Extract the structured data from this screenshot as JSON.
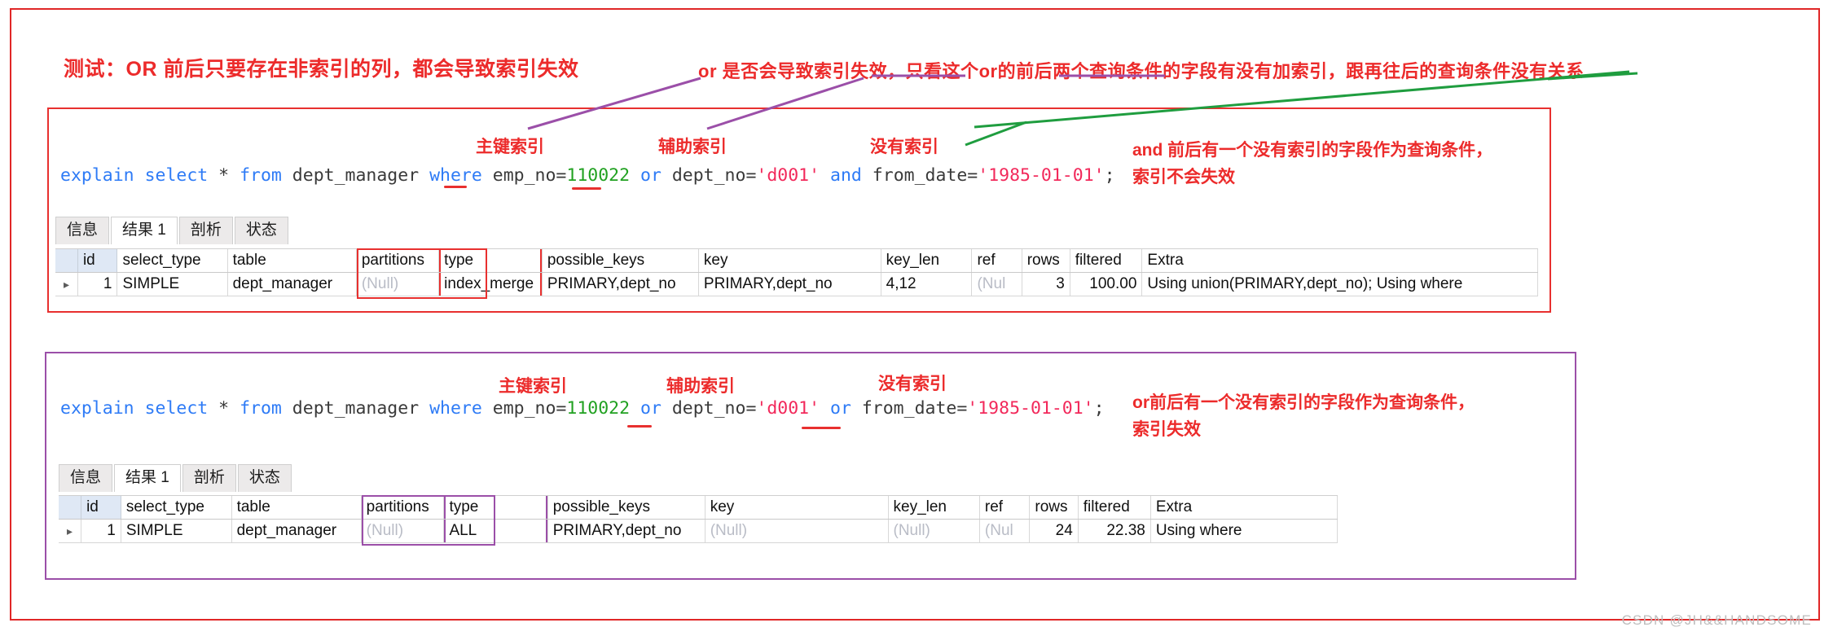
{
  "headlines": {
    "main_title": "测试：OR 前后只要存在非索引的列，都会导致索引失效",
    "or_rule": "or 是否会导致索引失效，只看这个or的前后两个查询条件的字段有没有加索引，跟再往后的查询条件没有关系"
  },
  "labels": {
    "primary_index": "主键索引",
    "secondary_index": "辅助索引",
    "no_index": "没有索引"
  },
  "blocks": [
    {
      "id": "and-block",
      "accent": "#e8302f",
      "note_line1": "and 前后有一个没有索引的字段作为查询条件，",
      "note_line2": "索引不会失效",
      "sql": {
        "full": "explain select * from dept_manager where emp_no=110022 or dept_no='d001' and from_date='1985-01-01';",
        "tokens": [
          {
            "t": "explain",
            "c": "kw"
          },
          {
            "t": " ",
            "c": "plain"
          },
          {
            "t": "select",
            "c": "kw"
          },
          {
            "t": " * ",
            "c": "plain"
          },
          {
            "t": "from",
            "c": "kw"
          },
          {
            "t": " dept_manager ",
            "c": "plain"
          },
          {
            "t": "where",
            "c": "kw"
          },
          {
            "t": " emp_no=",
            "c": "plain"
          },
          {
            "t": "110022",
            "c": "num"
          },
          {
            "t": " ",
            "c": "plain"
          },
          {
            "t": "or",
            "c": "kw"
          },
          {
            "t": " dept_no=",
            "c": "plain"
          },
          {
            "t": "'d001'",
            "c": "str"
          },
          {
            "t": " ",
            "c": "plain"
          },
          {
            "t": "and",
            "c": "kw"
          },
          {
            "t": " from_date=",
            "c": "plain"
          },
          {
            "t": "'1985-01-01'",
            "c": "str"
          },
          {
            "t": ";",
            "c": "plain"
          }
        ]
      },
      "tabs": [
        {
          "label": "信息",
          "active": false
        },
        {
          "label": "结果 1",
          "active": true
        },
        {
          "label": "剖析",
          "active": false
        },
        {
          "label": "状态",
          "active": false
        }
      ],
      "grid": {
        "columns": [
          "id",
          "select_type",
          "table",
          "partitions",
          "type",
          "possible_keys",
          "key",
          "key_len",
          "ref",
          "rows",
          "filtered",
          "Extra"
        ],
        "rows": [
          {
            "marker": "▸",
            "cells": [
              "1",
              "SIMPLE",
              "dept_manager",
              "(Null)",
              "index_merge",
              "PRIMARY,dept_no",
              "PRIMARY,dept_no",
              "4,12",
              "(Nul",
              "3",
              "100.00",
              "Using union(PRIMARY,dept_no); Using where"
            ]
          }
        ]
      }
    },
    {
      "id": "or-block",
      "accent": "#9b4fa8",
      "note_line1": "or前后有一个没有索引的字段作为查询条件，",
      "note_line2": "索引失效",
      "sql": {
        "full": "explain select * from dept_manager where emp_no=110022 or dept_no='d001' or from_date='1985-01-01';",
        "tokens": [
          {
            "t": "explain",
            "c": "kw"
          },
          {
            "t": " ",
            "c": "plain"
          },
          {
            "t": "select",
            "c": "kw"
          },
          {
            "t": " * ",
            "c": "plain"
          },
          {
            "t": "from",
            "c": "kw"
          },
          {
            "t": " dept_manager ",
            "c": "plain"
          },
          {
            "t": "where",
            "c": "kw"
          },
          {
            "t": " emp_no=",
            "c": "plain"
          },
          {
            "t": "110022",
            "c": "num"
          },
          {
            "t": " ",
            "c": "plain"
          },
          {
            "t": "or",
            "c": "kw"
          },
          {
            "t": " dept_no=",
            "c": "plain"
          },
          {
            "t": "'d001'",
            "c": "str"
          },
          {
            "t": " ",
            "c": "plain"
          },
          {
            "t": "or",
            "c": "kw"
          },
          {
            "t": " from_date=",
            "c": "plain"
          },
          {
            "t": "'1985-01-01'",
            "c": "str"
          },
          {
            "t": ";",
            "c": "plain"
          }
        ]
      },
      "tabs": [
        {
          "label": "信息",
          "active": false
        },
        {
          "label": "结果 1",
          "active": true
        },
        {
          "label": "剖析",
          "active": false
        },
        {
          "label": "状态",
          "active": false
        }
      ],
      "grid": {
        "columns": [
          "id",
          "select_type",
          "table",
          "partitions",
          "type",
          "possible_keys",
          "key",
          "key_len",
          "ref",
          "rows",
          "filtered",
          "Extra"
        ],
        "rows": [
          {
            "marker": "▸",
            "cells": [
              "1",
              "SIMPLE",
              "dept_manager",
              "(Null)",
              "ALL",
              "PRIMARY,dept_no",
              "(Null)",
              "(Null)",
              "(Nul",
              "24",
              "22.38",
              "Using where"
            ]
          }
        ]
      }
    }
  ],
  "watermark": "CSDN @JH&&HANDSOME",
  "colors": {
    "red": "#e8302f",
    "purple": "#9b4fa8",
    "green": "#1f9d3f",
    "annotation_text": "#ec2b2b"
  }
}
